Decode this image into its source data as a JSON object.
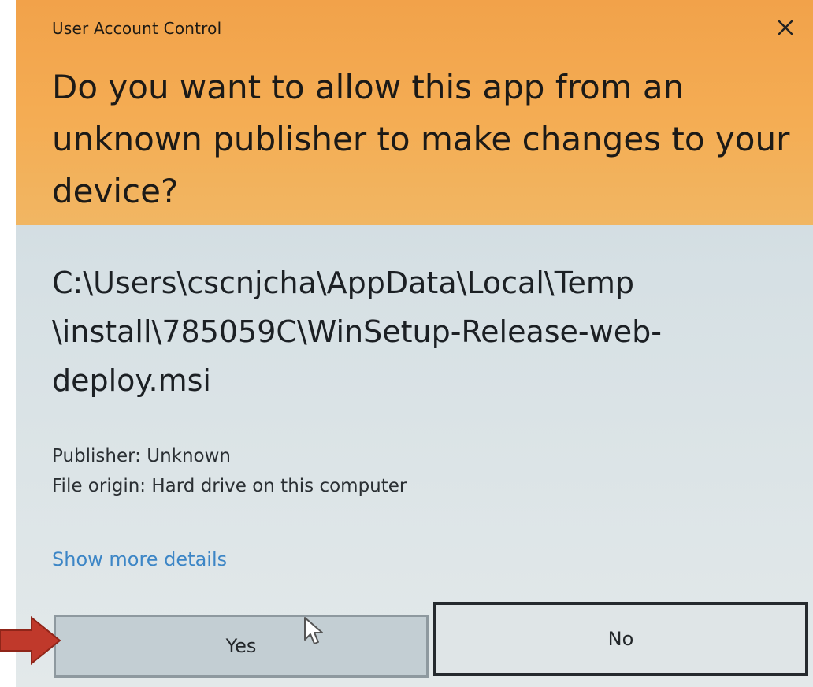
{
  "window": {
    "title": "User Account Control",
    "close_icon": "close-icon"
  },
  "prompt": {
    "question": "Do you want to allow this app from an\nunknown publisher to make changes to your\ndevice?"
  },
  "program": {
    "path": "C:\\Users\\cscnjcha\\AppData\\Local\\Temp\n\\install\\785059C\\WinSetup-Release-web-\ndeploy.msi",
    "publisher": "Publisher: Unknown",
    "file_origin": "File origin: Hard drive on this computer"
  },
  "links": {
    "show_more_details": "Show more details"
  },
  "buttons": {
    "yes_label": "Yes",
    "no_label": "No"
  },
  "colors": {
    "header": "#f4ad54",
    "body": "#d6e0e4",
    "link": "#3d86c6",
    "annotation_arrow": "#c0392b"
  },
  "annotations": {
    "pointer_arrow_icon": "red-arrow-icon",
    "mouse_cursor_icon": "mouse-pointer-icon"
  }
}
